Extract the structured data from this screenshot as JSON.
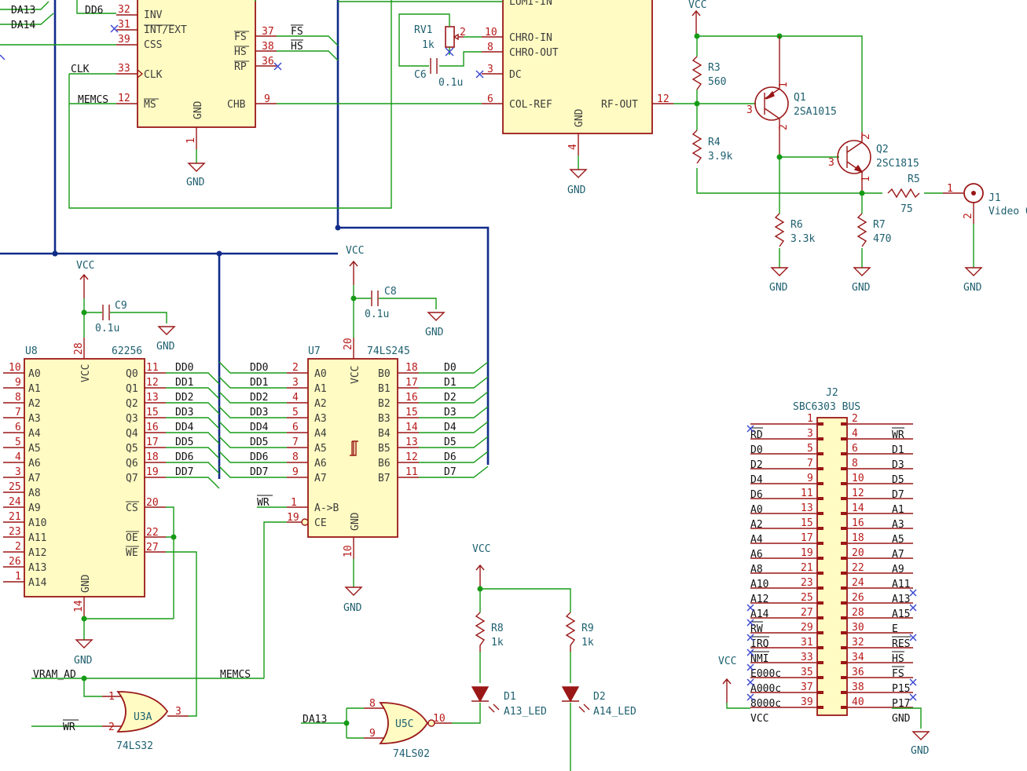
{
  "power": {
    "vcc": "VCC",
    "gnd": "GND"
  },
  "vdg": {
    "pins_left": [
      {
        "num": "32",
        "name": "INV",
        "net": "DD6"
      },
      {
        "num": "31",
        "name": "INT/EXT",
        "net": ""
      },
      {
        "num": "39",
        "name": "CSS",
        "net": ""
      },
      {
        "num": "33",
        "name": "CLK",
        "net": "CLK"
      },
      {
        "num": "12",
        "name": "MS",
        "net": "MEMCS"
      }
    ],
    "pins_right": [
      {
        "num": "37",
        "name": "FS",
        "net": "FS"
      },
      {
        "num": "38",
        "name": "HS",
        "net": "HS"
      },
      {
        "num": "36",
        "name": "RP",
        "net": ""
      },
      {
        "num": "9",
        "name": "CHB",
        "net": ""
      }
    ],
    "gnd_pin": "GND",
    "gnd_num": "1",
    "nets_top_left": [
      "DA13",
      "DA14"
    ]
  },
  "encoder": {
    "pins_left": [
      {
        "num": "",
        "name": "LUMI-IN"
      },
      {
        "num": "10",
        "name": "CHRO-IN"
      },
      {
        "num": "8",
        "name": "CHRO-OUT"
      },
      {
        "num": "3",
        "name": "DC"
      },
      {
        "num": "6",
        "name": "COL-REF"
      }
    ],
    "rf_out": "RF-OUT",
    "rf_num": "12",
    "gnd_pin": "GND",
    "gnd_num": "4"
  },
  "rv1": {
    "ref": "RV1",
    "value": "1k",
    "wiper": "2"
  },
  "c6": {
    "ref": "C6",
    "value": "0.1u"
  },
  "c8": {
    "ref": "C8",
    "value": "0.1u"
  },
  "c9": {
    "ref": "C9",
    "value": "0.1u"
  },
  "r3": {
    "ref": "R3",
    "value": "560"
  },
  "r4": {
    "ref": "R4",
    "value": "3.9k"
  },
  "r5": {
    "ref": "R5",
    "value": "75"
  },
  "r6": {
    "ref": "R6",
    "value": "3.3k"
  },
  "r7": {
    "ref": "R7",
    "value": "470"
  },
  "r8": {
    "ref": "R8",
    "value": "1k"
  },
  "r9": {
    "ref": "R9",
    "value": "1k"
  },
  "q1": {
    "ref": "Q1",
    "value": "2SA1015",
    "pins": [
      "1",
      "2",
      "3"
    ]
  },
  "q2": {
    "ref": "Q2",
    "value": "2SC1815",
    "pins": [
      "1",
      "2",
      "3"
    ]
  },
  "j1": {
    "ref": "J1",
    "value": "Video O",
    "pins": [
      "1",
      "2"
    ]
  },
  "u8": {
    "ref": "U8",
    "value": "62256",
    "vcc_pin": "VCC",
    "vcc_num": "28",
    "gnd_pin": "GND",
    "gnd_num": "14",
    "addr": [
      {
        "num": "10",
        "name": "A0"
      },
      {
        "num": "9",
        "name": "A1"
      },
      {
        "num": "8",
        "name": "A2"
      },
      {
        "num": "7",
        "name": "A3"
      },
      {
        "num": "6",
        "name": "A4"
      },
      {
        "num": "5",
        "name": "A5"
      },
      {
        "num": "4",
        "name": "A6"
      },
      {
        "num": "3",
        "name": "A7"
      },
      {
        "num": "25",
        "name": "A8"
      },
      {
        "num": "24",
        "name": "A9"
      },
      {
        "num": "21",
        "name": "A10"
      },
      {
        "num": "23",
        "name": "A11"
      },
      {
        "num": "2",
        "name": "A12"
      },
      {
        "num": "26",
        "name": "A13"
      },
      {
        "num": "1",
        "name": "A14"
      }
    ],
    "data": [
      {
        "num": "11",
        "name": "Q0",
        "net": "DD0"
      },
      {
        "num": "12",
        "name": "Q1",
        "net": "DD1"
      },
      {
        "num": "13",
        "name": "Q2",
        "net": "DD2"
      },
      {
        "num": "15",
        "name": "Q3",
        "net": "DD3"
      },
      {
        "num": "16",
        "name": "Q4",
        "net": "DD4"
      },
      {
        "num": "17",
        "name": "Q5",
        "net": "DD5"
      },
      {
        "num": "18",
        "name": "Q6",
        "net": "DD6"
      },
      {
        "num": "19",
        "name": "Q7",
        "net": "DD7"
      }
    ],
    "ctrl": [
      {
        "num": "20",
        "name": "CS"
      },
      {
        "num": "22",
        "name": "OE"
      },
      {
        "num": "27",
        "name": "WE"
      }
    ]
  },
  "u7": {
    "ref": "U7",
    "value": "74LS245",
    "vcc_pin": "VCC",
    "vcc_num": "20",
    "gnd_pin": "GND",
    "gnd_num": "10",
    "a": [
      {
        "num": "2",
        "name": "A0",
        "net": "DD0"
      },
      {
        "num": "3",
        "name": "A1",
        "net": "DD1"
      },
      {
        "num": "4",
        "name": "A2",
        "net": "DD2"
      },
      {
        "num": "5",
        "name": "A3",
        "net": "DD3"
      },
      {
        "num": "6",
        "name": "A4",
        "net": "DD4"
      },
      {
        "num": "7",
        "name": "A5",
        "net": "DD5"
      },
      {
        "num": "8",
        "name": "A6",
        "net": "DD6"
      },
      {
        "num": "9",
        "name": "A7",
        "net": "DD7"
      }
    ],
    "b": [
      {
        "num": "18",
        "name": "B0",
        "net": "D0"
      },
      {
        "num": "17",
        "name": "B1",
        "net": "D1"
      },
      {
        "num": "16",
        "name": "B2",
        "net": "D2"
      },
      {
        "num": "15",
        "name": "B3",
        "net": "D3"
      },
      {
        "num": "14",
        "name": "B4",
        "net": "D4"
      },
      {
        "num": "13",
        "name": "B5",
        "net": "D5"
      },
      {
        "num": "12",
        "name": "B6",
        "net": "D6"
      },
      {
        "num": "11",
        "name": "B7",
        "net": "D7"
      }
    ],
    "dir": {
      "num": "1",
      "name": "A->B",
      "net": "WR"
    },
    "ce": {
      "num": "19",
      "name": "CE"
    }
  },
  "u3a": {
    "ref": "U3A",
    "value": "74LS32",
    "pins": [
      "1",
      "2",
      "3"
    ],
    "net_in1": "VRAM_AD",
    "net_in2": "WR",
    "net_out": "MEMCS"
  },
  "u5c": {
    "ref": "U5C",
    "value": "74LS02",
    "pins": [
      "8",
      "9",
      "10"
    ],
    "net_in": "DA13"
  },
  "d1": {
    "ref": "D1",
    "value": "A13_LED"
  },
  "d2": {
    "ref": "D2",
    "value": "A14_LED"
  },
  "j2": {
    "ref": "J2",
    "value": "SBC6303 BUS",
    "rows": [
      {
        "l": "RD",
        "ln": "1",
        "rn": "2",
        "r": "WR"
      },
      {
        "l": "D0",
        "ln": "3",
        "rn": "4",
        "r": "D1"
      },
      {
        "l": "D2",
        "ln": "5",
        "rn": "6",
        "r": "D3"
      },
      {
        "l": "D4",
        "ln": "7",
        "rn": "8",
        "r": "D5"
      },
      {
        "l": "D6",
        "ln": "9",
        "rn": "10",
        "r": "D7"
      },
      {
        "l": "A0",
        "ln": "11",
        "rn": "12",
        "r": "A1"
      },
      {
        "l": "A2",
        "ln": "13",
        "rn": "14",
        "r": "A3"
      },
      {
        "l": "A4",
        "ln": "15",
        "rn": "16",
        "r": "A5"
      },
      {
        "l": "A6",
        "ln": "17",
        "rn": "18",
        "r": "A7"
      },
      {
        "l": "A8",
        "ln": "19",
        "rn": "20",
        "r": "A9"
      },
      {
        "l": "A10",
        "ln": "21",
        "rn": "22",
        "r": "A11"
      },
      {
        "l": "A12",
        "ln": "23",
        "rn": "24",
        "r": "A13"
      },
      {
        "l": "A14",
        "ln": "25",
        "rn": "26",
        "r": "A15"
      },
      {
        "l": "RW",
        "ln": "27",
        "rn": "28",
        "r": "E"
      },
      {
        "l": "IRQ",
        "ln": "29",
        "rn": "30",
        "r": "RES"
      },
      {
        "l": "NMI",
        "ln": "31",
        "rn": "32",
        "r": "HS"
      },
      {
        "l": "E000c",
        "ln": "33",
        "rn": "34",
        "r": "FS"
      },
      {
        "l": "A000c",
        "ln": "35",
        "rn": "36",
        "r": "P15"
      },
      {
        "l": "8000c",
        "ln": "37",
        "rn": "38",
        "r": "P17"
      },
      {
        "l": "VCC",
        "ln": "39",
        "rn": "40",
        "r": "GND"
      }
    ]
  }
}
